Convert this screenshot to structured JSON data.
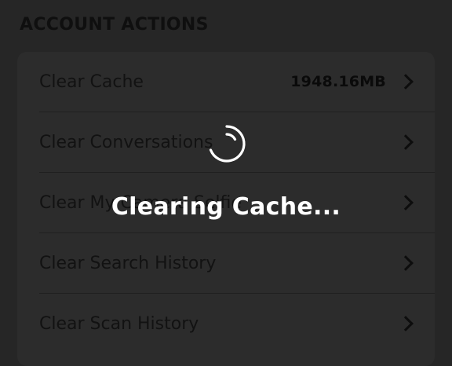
{
  "section": {
    "title": "ACCOUNT ACTIONS"
  },
  "rows": [
    {
      "label": "Clear Cache",
      "value": "1948.16MB"
    },
    {
      "label": "Clear Conversations"
    },
    {
      "label": "Clear My Camera Selfie"
    },
    {
      "label": "Clear Search History"
    },
    {
      "label": "Clear Scan History"
    }
  ],
  "overlay": {
    "message": "Clearing Cache...",
    "spinner_icon": "loading-spinner-icon"
  },
  "colors": {
    "background": "#262626",
    "overlay_text": "#ffffff"
  }
}
